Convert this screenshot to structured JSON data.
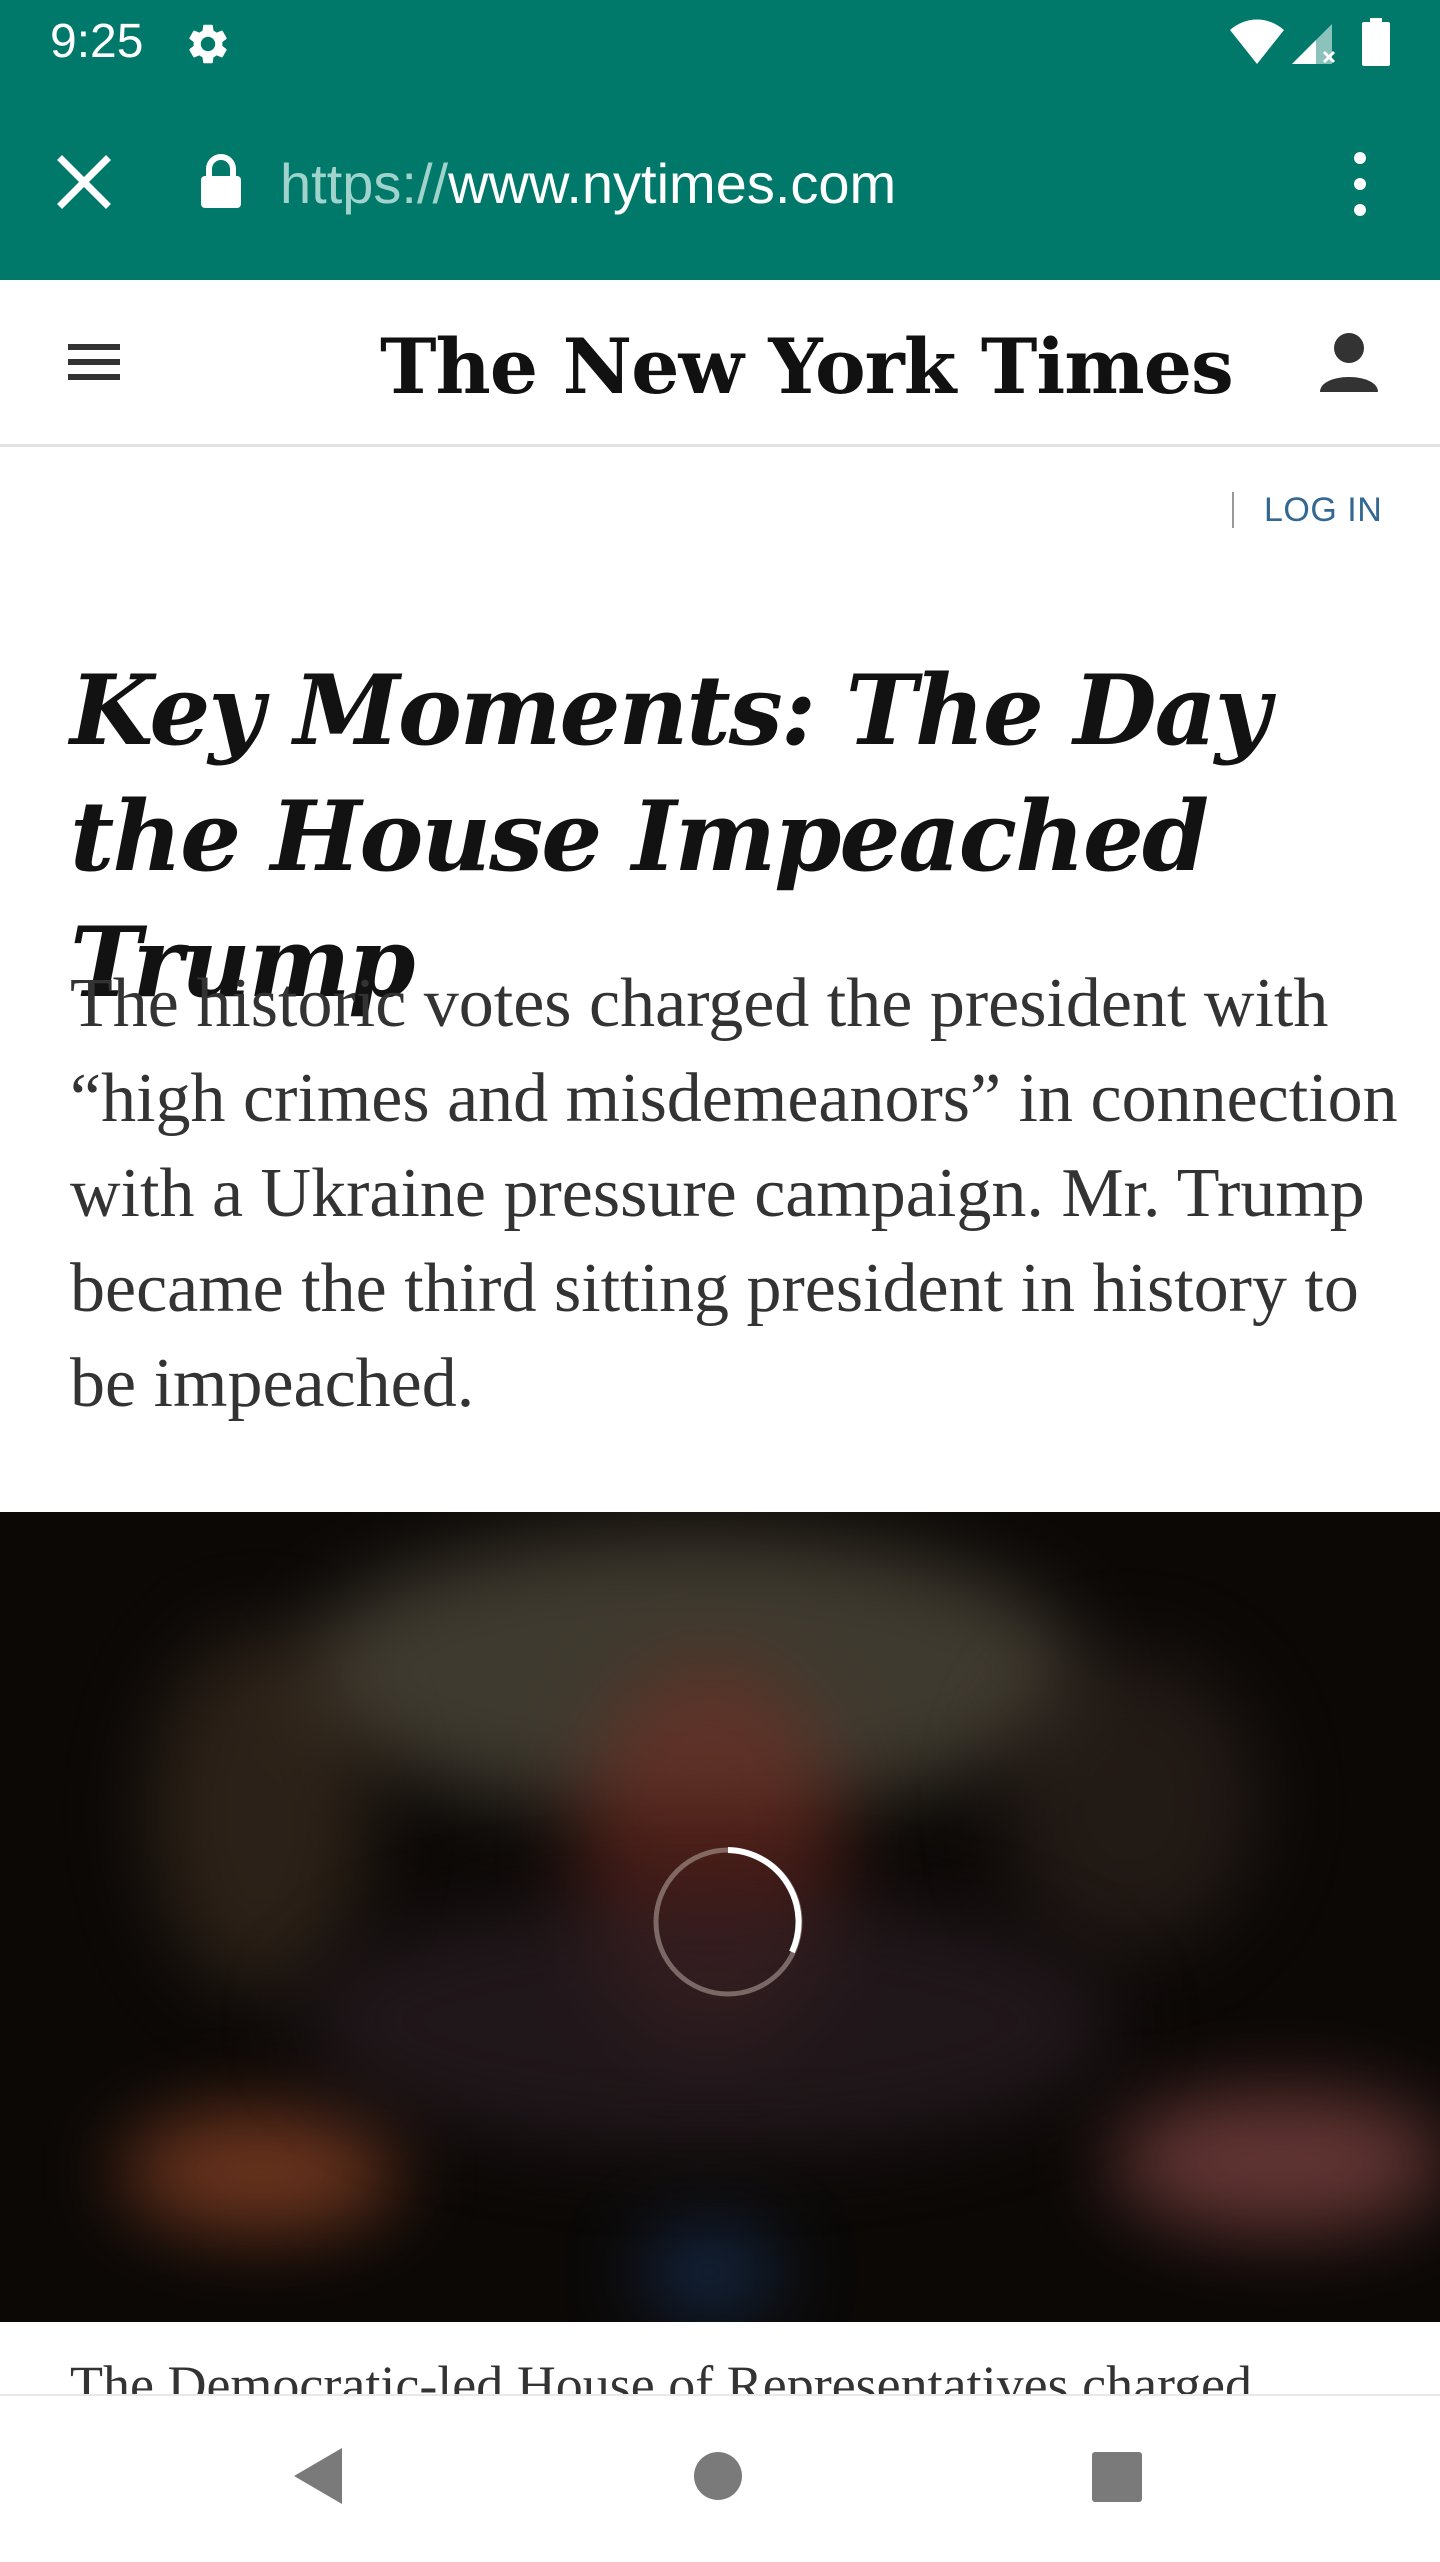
{
  "status_bar": {
    "time": "9:25",
    "icons": [
      "gear-icon",
      "wifi-icon",
      "signal-icon",
      "battery-icon"
    ]
  },
  "browser": {
    "url_scheme": "https://",
    "url_host": "www.nytimes.com",
    "icons": [
      "close-icon",
      "lock-icon",
      "more-vert-icon"
    ],
    "accent_color": "#00796b"
  },
  "site_header": {
    "logo_text": "The New York Times",
    "icons": [
      "hamburger-icon",
      "account-icon"
    ]
  },
  "login": {
    "label": "LOG IN",
    "link_color": "#326891"
  },
  "article": {
    "headline": "Key Moments: The Day the House Impeached Trump",
    "summary": "The historic votes charged the president with “high crimes and misdemeanors” in connection with a Ukraine pressure campaign. Mr. Trump became the third sitting president in history to be impeached.",
    "caption": "The Democratic-led House of Representatives charged"
  },
  "video": {
    "state": "loading",
    "icons": [
      "loading-spinner-icon"
    ]
  },
  "nav_bar": {
    "icons": [
      "back-icon",
      "home-icon",
      "recents-icon"
    ]
  }
}
